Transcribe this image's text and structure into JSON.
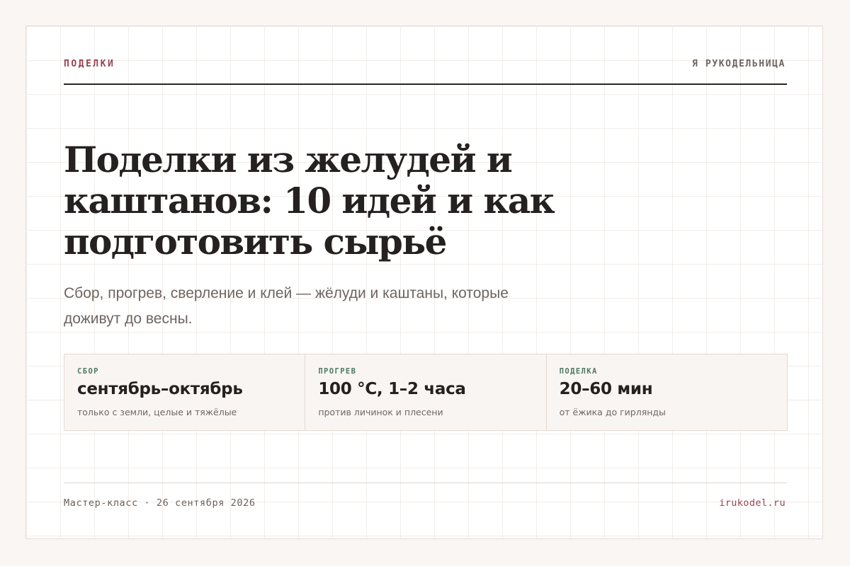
{
  "header": {
    "kicker": "ПОДЕЛКИ",
    "brand": "Я РУКОДЕЛЬНИЦА"
  },
  "article": {
    "title": "Поделки из желудей и каштанов: 10 идей и как подготовить сырьё",
    "subtitle": "Сбор, прогрев, сверление и клей — жёлуди и каштаны, которые доживут до весны."
  },
  "stats": [
    {
      "label": "СБОР",
      "value": "сентябрь–октябрь",
      "note": "только с земли, целые и тяжёлые"
    },
    {
      "label": "ПРОГРЕВ",
      "value": "100 °C, 1–2 часа",
      "note": "против личинок и плесени"
    },
    {
      "label": "ПОДЕЛКА",
      "value": "20–60 мин",
      "note": "от ёжика до гирлянды"
    }
  ],
  "footer": {
    "meta": "Мастер-класс · 26 сентября 2026",
    "site": "irukodel.ru"
  },
  "colors": {
    "accent": "#9a4354",
    "label_green": "#4d7a61",
    "text": "#242120",
    "background": "#faf6f3"
  }
}
